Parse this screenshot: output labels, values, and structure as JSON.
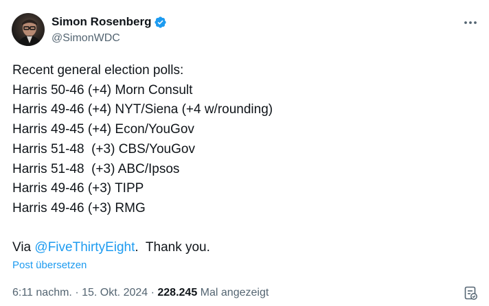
{
  "author": {
    "display_name": "Simon Rosenberg",
    "handle": "@SimonWDC",
    "verified": true,
    "avatar_icon": "profile-photo"
  },
  "tweet": {
    "lines": [
      "Recent general election polls:",
      "Harris 50-46 (+4) Morn Consult",
      "Harris 49-46 (+4) NYT/Siena (+4 w/rounding)",
      "Harris 49-45 (+4) Econ/YouGov",
      "Harris 51-48  (+3) CBS/YouGov",
      "Harris 51-48  (+3) ABC/Ipsos",
      "Harris 49-46 (+3) TIPP",
      "Harris 49-46 (+3) RMG"
    ],
    "closing_prefix": "Via ",
    "closing_mention": "@FiveThirtyEight",
    "closing_suffix": ".  Thank you."
  },
  "translate_label": "Post übersetzen",
  "meta": {
    "time": "6:11 nachm.",
    "separator1": " · ",
    "date": "15. Okt. 2024",
    "separator2": " · ",
    "view_count": "228.245",
    "views_label": " Mal angezeigt"
  },
  "icons": {
    "more": "more-dots-icon",
    "verified": "verified-badge-icon",
    "analytics": "analytics-icon"
  },
  "colors": {
    "accent": "#1d9bf0",
    "text": "#0f1419",
    "secondary": "#536471"
  }
}
